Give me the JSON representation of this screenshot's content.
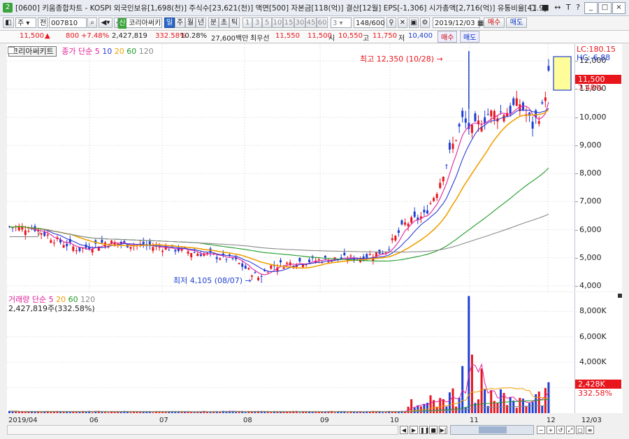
{
  "window": {
    "badge": "2",
    "title": "[0600] 키움종합차트 - KOSPI 외국인보유[1,698(천)] 주식수[23,621(천)] 액면[500] 자본금[118(억)] 결산[12월] EPS[-1,306] 시가총액[2,716(억)] 유통비율[41.9]",
    "title_icons": [
      "□",
      "■",
      "↔",
      "T",
      "?"
    ],
    "controls": [
      "_",
      "□",
      "×"
    ]
  },
  "toolbar": {
    "market_select": "주",
    "stock_prefix": "전",
    "stock_code": "007810",
    "stock_name_badge": "신",
    "stock_name": "코리아써키",
    "periods": [
      "일",
      "주",
      "월",
      "년",
      "분",
      "초",
      "틱"
    ],
    "active_period": "일",
    "intervals": [
      "1",
      "3",
      "5",
      "10",
      "15",
      "30",
      "45",
      "60"
    ],
    "interval_select": "3",
    "count": "148",
    "count_max": "/600",
    "date": "2019/12/03",
    "buy": "매수",
    "sell": "매도"
  },
  "quote": {
    "price": "11,500",
    "change_arrow": "▲",
    "change": "800",
    "change_pct": "+7.48%",
    "volume": "2,427,819",
    "vol_ratio": "332.58%",
    "turnover": "10.28%",
    "amount": "27,600백만",
    "pref_label": "최우선",
    "best_ask": "11,550",
    "best_bid": "11,500",
    "open_label": "시",
    "open": "10,550",
    "high_label": "고",
    "high": "11,750",
    "low_label": "저",
    "low": "10,400"
  },
  "price_panel": {
    "name_box": "코리아써키트",
    "legend_prefix": "종가 단순",
    "ma_labels": [
      "5",
      "10",
      "20",
      "60",
      "120"
    ],
    "lc": "LC:180.15",
    "hc": "HC:-6.88",
    "current_price": "11,500",
    "current_pct": "7.48%",
    "high_note": "최고 12,350 (10/28) →",
    "low_note": "최저 4,105 (08/07) →",
    "y_ticks": [
      "12,000",
      "11,000",
      "10,000",
      "9,000",
      "8,000",
      "7,000",
      "6,000",
      "5,000",
      "4,000"
    ]
  },
  "volume_panel": {
    "legend_prefix": "거래량 단순",
    "ma_labels": [
      "5",
      "20",
      "60",
      "120"
    ],
    "value_line": "2,427,819주(332.58%)",
    "current": "2,428K",
    "current_pct": "332.58%",
    "y_ticks": [
      "8,000K",
      "6,000K",
      "4,000K"
    ]
  },
  "x_axis": {
    "labels": [
      "2019/04",
      "06",
      "07",
      "08",
      "09",
      "10",
      "11",
      "12",
      "12/03"
    ]
  },
  "colors": {
    "up": "#e8151b",
    "down": "#1e3fd1",
    "ma5": "#e0209a",
    "ma10": "#2b3bd8",
    "ma20": "#f0a000",
    "ma60": "#1f9a2a",
    "ma120": "#8a8a8a"
  },
  "chart_data": {
    "type": "candlestick",
    "series_closes_sampled": [
      {
        "period": "2019/04",
        "close": 6100
      },
      {
        "period": "06",
        "close": 5600
      },
      {
        "period": "07",
        "close": 5400
      },
      {
        "period": "08",
        "close": 4105
      },
      {
        "period": "09",
        "close": 4900
      },
      {
        "period": "10",
        "close": 7500
      },
      {
        "period": "11",
        "close": 10300
      },
      {
        "period": "12",
        "close": 11500
      }
    ],
    "high": {
      "value": 12350,
      "date": "10/28"
    },
    "low": {
      "value": 4105,
      "date": "08/07"
    },
    "ylim": [
      3800,
      12600
    ],
    "volume_ylim": [
      0,
      9500
    ]
  }
}
